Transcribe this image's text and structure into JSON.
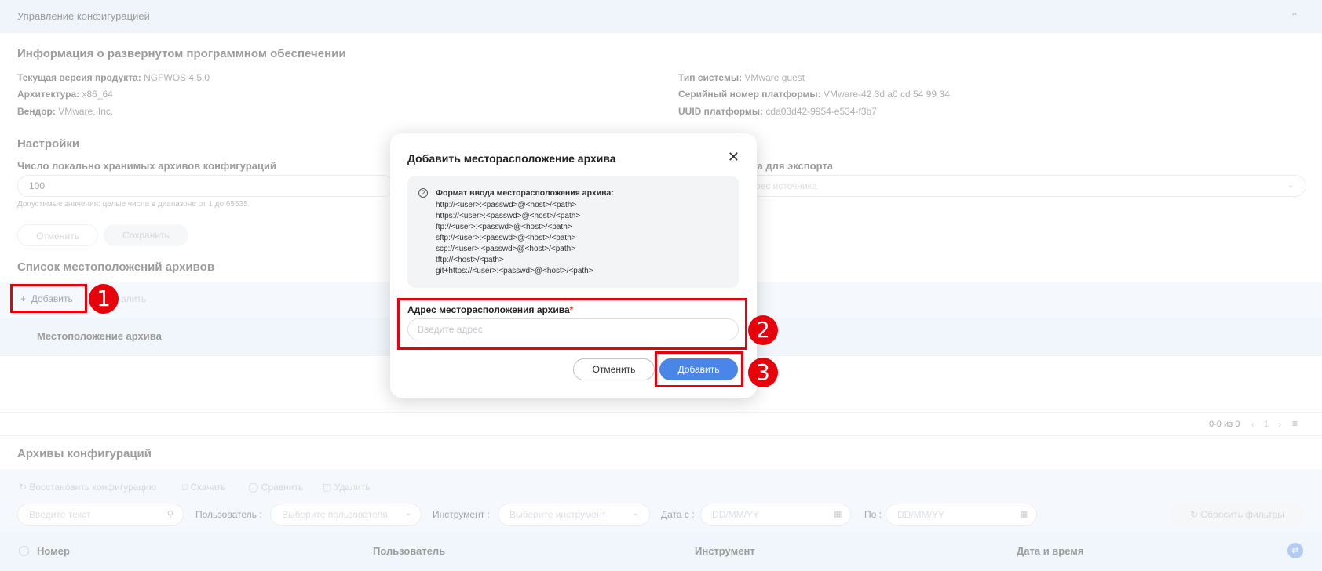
{
  "header": {
    "title": "Управление конфигурацией",
    "collapse_icon": "chevron-up-icon"
  },
  "software_info": {
    "title": "Информация о развернутом программном обеспечении",
    "left": [
      {
        "label": "Текущая версия продукта:",
        "value": "NGFWOS 4.5.0"
      },
      {
        "label": "Архитектура:",
        "value": "x86_64"
      },
      {
        "label": "Вендор:",
        "value": "VMware, Inc."
      }
    ],
    "right": [
      {
        "label": "Тип системы:",
        "value": "VMware guest"
      },
      {
        "label": "Серийный номер платформы:",
        "value": "VMware-42 3d a0 cd 54 99 34"
      },
      {
        "label": "UUID платформы:",
        "value": "cda03d42-9954-e534-f3b7"
      }
    ]
  },
  "settings": {
    "title": "Настройки",
    "archives_count_label": "Число локально хранимых архивов конфигураций",
    "archives_count_value": "100",
    "archives_count_hint": "Допустимые значения: целые числа в диапазоне от 1 до 65535.",
    "export_label": "ика для экспорта",
    "export_placeholder": "дрес источника",
    "cancel_label": "Отменить",
    "save_label": "Сохранить"
  },
  "locations": {
    "title": "Список местоположений архивов",
    "add_label": "Добавить",
    "delete_label": "алить",
    "column": "Местоположение архива",
    "pagination": "0-0 из 0",
    "page": "1"
  },
  "archives": {
    "title": "Архивы конфигураций",
    "restore_label": "Восстановить конфигурацию",
    "download_label": "Скачать",
    "compare_label": "Сравнить",
    "delete_label": "Удалить",
    "search_placeholder": "Введите текст",
    "user_label": "Пользователь :",
    "user_placeholder": "Выберите пользователя",
    "tool_label": "Инструмент :",
    "tool_placeholder": "Выберите инструмент",
    "date_from_label": "Дата с :",
    "date_placeholder": "DD/MM/YY",
    "date_to_label": "По :",
    "reset_label": "Сбросить фильтры",
    "columns": [
      "Номер",
      "Пользователь",
      "Инструмент",
      "Дата и время"
    ]
  },
  "dialog": {
    "title": "Добавить месторасположение архива",
    "format_title": "Формат ввода месторасположения архива:",
    "format_lines": [
      "http://<user>:<passwd>@<host>/<path>",
      "https://<user>:<passwd>@<host>/<path>",
      "ftp://<user>:<passwd>@<host>/<path>",
      "sftp://<user>:<passwd>@<host>/<path>",
      "scp://<user>:<passwd>@<host>/<path>",
      "tftp://<host>/<path>",
      "git+https://<user>:<passwd>@<host>/<path>"
    ],
    "address_label": "Адрес месторасположения архива",
    "required_mark": "*",
    "address_placeholder": "Введите адрес",
    "cancel_label": "Отменить",
    "add_label": "Добавить"
  },
  "annotations": [
    "1",
    "2",
    "3"
  ],
  "colors": {
    "highlight": "#e8000b",
    "primary": "#4a86e8",
    "header_bg": "#e3eef9"
  }
}
